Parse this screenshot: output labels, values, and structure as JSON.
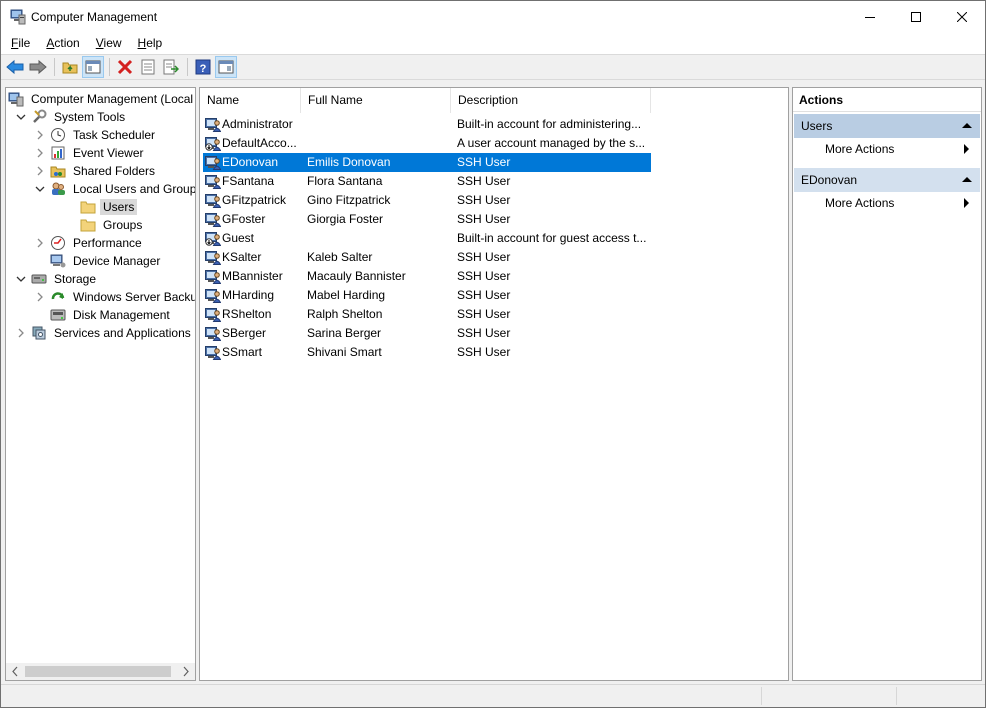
{
  "window": {
    "title": "Computer Management"
  },
  "menu": [
    {
      "label": "File",
      "key": "F",
      "rest": "ile"
    },
    {
      "label": "Action",
      "key": "A",
      "rest": "ction"
    },
    {
      "label": "View",
      "key": "V",
      "rest": "iew"
    },
    {
      "label": "Help",
      "key": "H",
      "rest": "elp"
    }
  ],
  "toolbar": {
    "icons": [
      "back-arrow-icon",
      "forward-arrow-icon",
      "up-folder-icon",
      "show-hide-console-tree-icon",
      "delete-icon",
      "properties-icon",
      "export-list-icon",
      "help-icon",
      "show-hide-action-pane-icon"
    ]
  },
  "tree": [
    {
      "label": "Computer Management (Local",
      "icon": "computer-management-icon",
      "level": 0,
      "expander": "none"
    },
    {
      "label": "System Tools",
      "icon": "system-tools-icon",
      "level": 1,
      "expander": "expanded"
    },
    {
      "label": "Task Scheduler",
      "icon": "clock-icon",
      "level": 2,
      "expander": "collapsed"
    },
    {
      "label": "Event Viewer",
      "icon": "event-viewer-icon",
      "level": 2,
      "expander": "collapsed"
    },
    {
      "label": "Shared Folders",
      "icon": "shared-folders-icon",
      "level": 2,
      "expander": "collapsed"
    },
    {
      "label": "Local Users and Groups",
      "icon": "users-groups-icon",
      "level": 2,
      "expander": "expanded"
    },
    {
      "label": "Users",
      "icon": "folder-icon",
      "level": 3,
      "expander": "none",
      "selected": true
    },
    {
      "label": "Groups",
      "icon": "folder-icon",
      "level": 3,
      "expander": "none"
    },
    {
      "label": "Performance",
      "icon": "performance-icon",
      "level": 2,
      "expander": "collapsed"
    },
    {
      "label": "Device Manager",
      "icon": "device-manager-icon",
      "level": 2,
      "expander": "none"
    },
    {
      "label": "Storage",
      "icon": "storage-icon",
      "level": 1,
      "expander": "expanded"
    },
    {
      "label": "Windows Server Backup",
      "icon": "backup-icon",
      "level": 2,
      "expander": "collapsed"
    },
    {
      "label": "Disk Management",
      "icon": "disk-management-icon",
      "level": 2,
      "expander": "none"
    },
    {
      "label": "Services and Applications",
      "icon": "services-icon",
      "level": 1,
      "expander": "collapsed"
    }
  ],
  "table": {
    "columns": [
      "Name",
      "Full Name",
      "Description"
    ],
    "rows": [
      {
        "name": "Administrator",
        "full_name": "",
        "description": "Built-in account for administering...",
        "icon": "user-icon"
      },
      {
        "name": "DefaultAcco...",
        "full_name": "",
        "description": "A user account managed by the s...",
        "icon": "disabled-user-icon"
      },
      {
        "name": "EDonovan",
        "full_name": "Emilis Donovan",
        "description": "SSH User",
        "icon": "user-icon",
        "selected": true
      },
      {
        "name": "FSantana",
        "full_name": "Flora Santana",
        "description": "SSH User",
        "icon": "user-icon"
      },
      {
        "name": "GFitzpatrick",
        "full_name": "Gino Fitzpatrick",
        "description": "SSH User",
        "icon": "user-icon"
      },
      {
        "name": "GFoster",
        "full_name": "Giorgia Foster",
        "description": "SSH User",
        "icon": "user-icon"
      },
      {
        "name": "Guest",
        "full_name": "",
        "description": "Built-in account for guest access t...",
        "icon": "disabled-user-icon"
      },
      {
        "name": "KSalter",
        "full_name": "Kaleb Salter",
        "description": "SSH User",
        "icon": "user-icon"
      },
      {
        "name": "MBannister",
        "full_name": "Macauly Bannister",
        "description": "SSH User",
        "icon": "user-icon"
      },
      {
        "name": "MHarding",
        "full_name": "Mabel Harding",
        "description": "SSH User",
        "icon": "user-icon"
      },
      {
        "name": "RShelton",
        "full_name": "Ralph Shelton",
        "description": "SSH User",
        "icon": "user-icon"
      },
      {
        "name": "SBerger",
        "full_name": "Sarina Berger",
        "description": "SSH User",
        "icon": "user-icon"
      },
      {
        "name": "SSmart",
        "full_name": "Shivani Smart",
        "description": "SSH User",
        "icon": "user-icon"
      }
    ]
  },
  "actions": {
    "title": "Actions",
    "groups": [
      {
        "label": "Users",
        "items": [
          "More Actions"
        ]
      },
      {
        "label": "EDonovan",
        "items": [
          "More Actions"
        ]
      }
    ]
  },
  "colors": {
    "selection": "#0078d7",
    "action_group_bg": "#b9cde3"
  }
}
